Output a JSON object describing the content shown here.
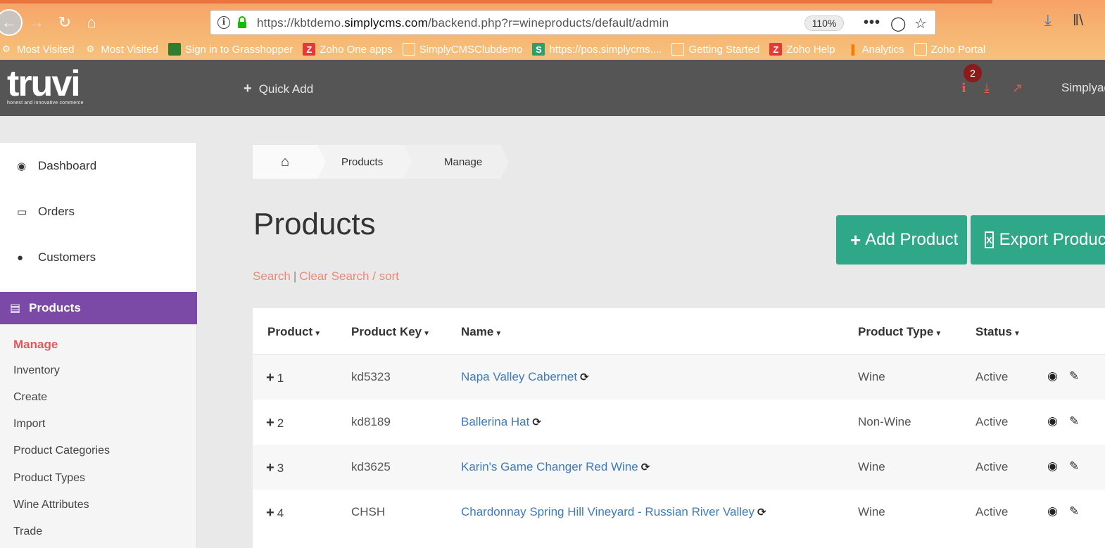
{
  "browser": {
    "url_prefix": "https://kbtdemo.",
    "url_domain": "simplycms.com",
    "url_path": "/backend.php?r=wineproducts/default/admin",
    "zoom": "110%",
    "bookmarks": [
      {
        "label": "Most Visited",
        "icon": "gear-icon"
      },
      {
        "label": "Most Visited",
        "icon": "gear-icon"
      },
      {
        "label": "Sign in to Grasshopper",
        "icon": "grasshopper-icon"
      },
      {
        "label": "Zoho One apps",
        "icon": "zoho-icon"
      },
      {
        "label": "SimplyCMSClubdemo",
        "icon": "globe-icon"
      },
      {
        "label": "https://pos.simplycms....",
        "icon": "s-icon"
      },
      {
        "label": "Getting Started",
        "icon": "globe-icon"
      },
      {
        "label": "Zoho Help",
        "icon": "zoho-icon"
      },
      {
        "label": "Analytics",
        "icon": "analytics-icon"
      },
      {
        "label": "Zoho Portal",
        "icon": "globe-icon"
      }
    ]
  },
  "header": {
    "logo_word": "truvi",
    "logo_tagline": "honest and innovative commerce",
    "quick_add": "Quick Add",
    "notification_count": "2",
    "user_name": "Simplyadmin"
  },
  "sidebar": {
    "items": [
      {
        "label": "Dashboard",
        "icon": "dashboard-icon"
      },
      {
        "label": "Orders",
        "icon": "credit-card-icon"
      },
      {
        "label": "Customers",
        "icon": "user-icon"
      }
    ],
    "active_section": "Products",
    "sub_items": [
      "Manage",
      "Inventory",
      "Create",
      "Import",
      "Product Categories",
      "Product Types",
      "Wine Attributes",
      "Trade"
    ]
  },
  "breadcrumb": {
    "items": [
      "Products",
      "Manage"
    ]
  },
  "main": {
    "title": "Products",
    "search_link": "Search",
    "separator": "|",
    "clear_link": "Clear Search / sort",
    "add_button": "Add Product",
    "export_button": "Export Products"
  },
  "table": {
    "columns": [
      "Product",
      "Product Key",
      "Name",
      "Product Type",
      "Status"
    ],
    "rows": [
      {
        "id": "1",
        "key": "kd5323",
        "name": "Napa Valley Cabernet",
        "type": "Wine",
        "status": "Active"
      },
      {
        "id": "2",
        "key": "kd8189",
        "name": "Ballerina Hat",
        "type": "Non-Wine",
        "status": "Active"
      },
      {
        "id": "3",
        "key": "kd3625",
        "name": "Karin's Game Changer Red Wine",
        "type": "Wine",
        "status": "Active"
      },
      {
        "id": "4",
        "key": "CHSH",
        "name": "Chardonnay Spring Hill Vineyard - Russian River Valley",
        "type": "Wine",
        "status": "Active"
      }
    ]
  },
  "colors": {
    "accent_purple": "#7a4aa6",
    "accent_green": "#2fa88a",
    "link_blue": "#3f7ab9",
    "link_red": "#e0585b"
  }
}
